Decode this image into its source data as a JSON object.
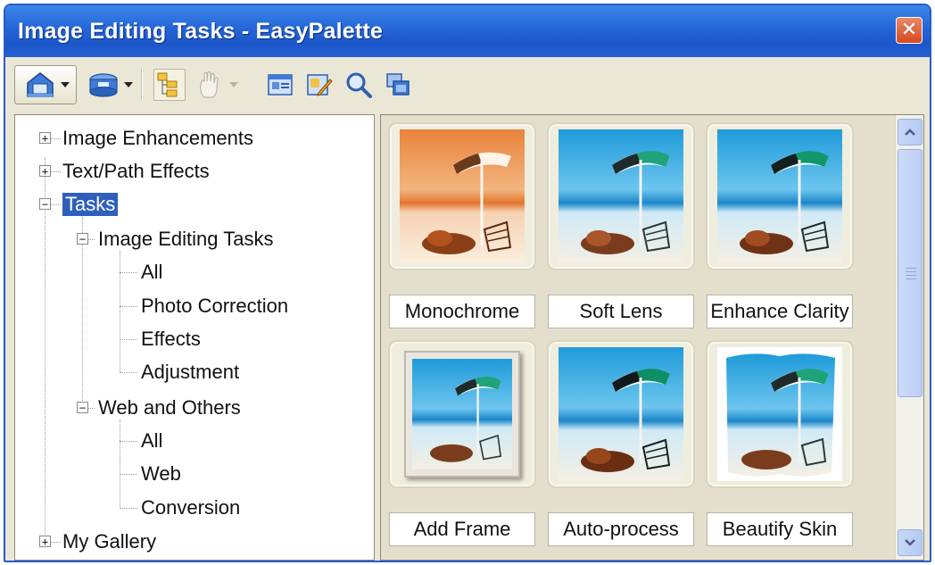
{
  "window": {
    "title": "Image Editing Tasks - EasyPalette",
    "close_glyph": "✕"
  },
  "toolbar": {
    "icons": [
      "home-icon",
      "disk-icon",
      "tree-view-icon",
      "hand-icon",
      "card-icon",
      "edit-icon",
      "magnifier-icon",
      "windows-icon"
    ]
  },
  "tree": {
    "image_enhancements": "Image Enhancements",
    "text_path_effects": "Text/Path Effects",
    "tasks": "Tasks",
    "image_editing_tasks": "Image Editing Tasks",
    "iet_all": "All",
    "iet_photo_correction": "Photo Correction",
    "iet_effects": "Effects",
    "iet_adjustment": "Adjustment",
    "web_and_others": "Web and Others",
    "wo_all": "All",
    "wo_web": "Web",
    "wo_conversion": "Conversion",
    "my_gallery": "My Gallery"
  },
  "gallery": {
    "items": [
      {
        "label": "Monochrome"
      },
      {
        "label": "Soft Lens"
      },
      {
        "label": "Enhance Clarity"
      },
      {
        "label": "Add Frame"
      },
      {
        "label": "Auto-process"
      },
      {
        "label": "Beautify Skin"
      }
    ]
  },
  "colors": {
    "titlebar": "#2565d8",
    "selection": "#2f5fbd",
    "panel": "#e9e6d6"
  }
}
